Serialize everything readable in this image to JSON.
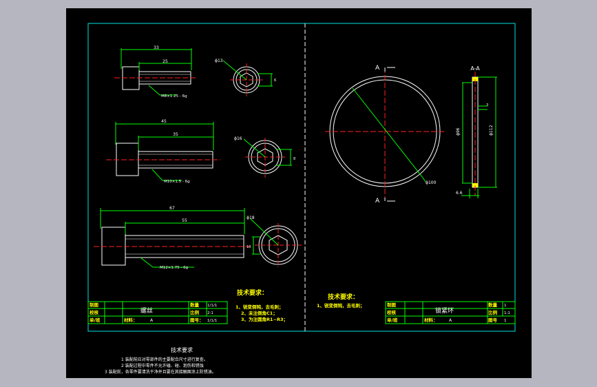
{
  "left_part": {
    "name": "螺丝",
    "table": {
      "made_by": "制图",
      "checked_by": "校核",
      "unit_class": "单/班",
      "material_label": "材料：",
      "material_value": "A",
      "qty_label": "数量",
      "qty_value": "1/1/1",
      "scale_label": "比例",
      "scale_value": "2:1",
      "drawing_label": "图号：",
      "drawing_value": "1/1/1"
    },
    "notes_title": "技术要求：",
    "notes": [
      "1、锐变倒钝，去毛刺；",
      "2、未注倒角C1；",
      "3、为注圆角R1~R3；"
    ]
  },
  "right_part": {
    "name": "锁紧环",
    "table": {
      "made_by": "制图",
      "checked_by": "校核",
      "unit_class": "单/班",
      "material_label": "材料：",
      "material_value": "A",
      "qty_label": "数量",
      "qty_value": "1",
      "scale_label": "比例",
      "scale_value": "1:1",
      "drawing_label": "图号",
      "drawing_value": "1"
    },
    "notes_title": "技术要求：",
    "notes": [
      "1、锐变倒钝，去毛刺；"
    ]
  },
  "assembly_notes": {
    "title": "技术要求",
    "items": [
      "1  装配前应对零部件的主要配合尺寸进行复查。",
      "2  装配过程中零件不允许磕、碰、划伤和锈蚀",
      "3  装配前，各零件要清洗干净并且要在其接触面涂上防锈油。"
    ]
  },
  "dimensions": {
    "bolt1_total": "33",
    "bolt1_thread": "25",
    "bolt1_spec": "M8×1.25 - 6g",
    "bolt1_head": "13",
    "bolt2_total": "45",
    "bolt2_thread": "35",
    "bolt2_spec": "M10×1.5 - 6g",
    "bolt2_head": "16",
    "bolt3_total": "67",
    "bolt3_thread": "55",
    "bolt3_spec": "M12×1.75 - 6g",
    "bolt3_head": "18",
    "ring_dia": "100",
    "ring_section_title": "A-A",
    "ring_inner": "96",
    "ring_outer": "112",
    "ring_width": "6.6",
    "ring_gap": "3",
    "section_mark": "A",
    "head_depth_1": "6",
    "head_depth_2": "8",
    "head_depth_3": "10"
  }
}
